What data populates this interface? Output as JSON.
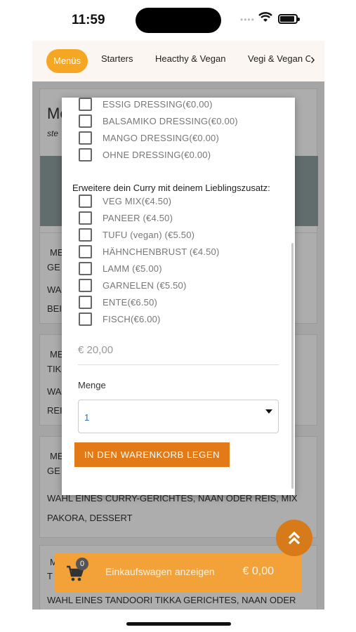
{
  "status_bar": {
    "time": "11:59"
  },
  "tabs": {
    "items": [
      "Menüs",
      "Starters",
      "Heacthy & Vegan",
      "Vegi & Vegan C"
    ],
    "active": "Menüs"
  },
  "background": {
    "heading": "Me",
    "subheading": "ste",
    "rows": [
      "ME",
      "GE",
      "WAH",
      "BEI",
      "ME",
      "TIK",
      "WA",
      "REI",
      "ME",
      "GE",
      "M",
      "T"
    ],
    "text_1": "WAHL EINES CURRY-GERICHTES, NAAN ODER REIS, MIX",
    "text_2": "PAKORA, DESSERT",
    "text_3": "WAHL EINES TANDOORI TIKKA GERICHTES, NAAN ODER"
  },
  "modal": {
    "dressing_options": [
      "ESSIG DRESSING(€0.00)",
      "BALSAMIKO DRESSING(€0.00)",
      "MANGO DRESSING(€0.00)",
      "OHNE DRESSING(€0.00)"
    ],
    "section_title": "Erweitere dein Curry mit deinem Lieblingszusatz:",
    "extra_options": [
      "VEG MIX(€4.50)",
      "PANEER (€4.50)",
      "TUFU (vegan) (€5.50)",
      "HÄHNCHENBRUST (€4.50)",
      "LAMM (€5.00)",
      "GARNELEN (€5.50)",
      "ENTE(€6.50)",
      "FISCH(€6.00)"
    ],
    "price": "€ 20,00",
    "quantity_label": "Menge",
    "quantity_value": "1",
    "add_button": "IN DEN WARENKORB LEGEN"
  },
  "cart": {
    "badge": "0",
    "label": "Einkaufswagen anzeigen",
    "total": "€ 0,00"
  },
  "colors": {
    "accent": "#f5a623",
    "button": "#e27a18",
    "fab": "#d67a1a"
  }
}
